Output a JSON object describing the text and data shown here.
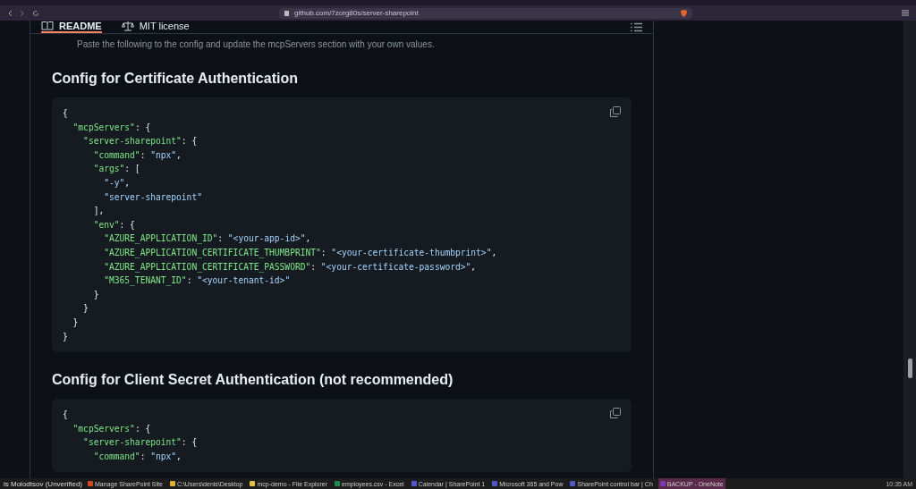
{
  "browser": {
    "url": "github.com/7zorg80s/server-sharepoint"
  },
  "readme_tabs": [
    {
      "label": "README",
      "selected": true
    },
    {
      "label": "MIT license",
      "selected": false
    }
  ],
  "intro": "Paste the following to the config and update the mcpServers section with your own values.",
  "sections": [
    {
      "heading": "Config for Certificate Authentication",
      "code": [
        [
          {
            "punct": "{"
          }
        ],
        [
          {
            "key": "  \"mcpServers\""
          },
          {
            "punct": ": {"
          }
        ],
        [
          {
            "key": "    \"server-sharepoint\""
          },
          {
            "punct": ": {"
          }
        ],
        [
          {
            "key": "      \"command\""
          },
          {
            "punct": ": "
          },
          {
            "str": "\"npx\""
          },
          {
            "punct": ","
          }
        ],
        [
          {
            "key": "      \"args\""
          },
          {
            "punct": ": ["
          }
        ],
        [
          {
            "str": "        \"-y\""
          },
          {
            "punct": ","
          }
        ],
        [
          {
            "str": "        \"server-sharepoint\""
          }
        ],
        [
          {
            "punct": "      ],"
          }
        ],
        [
          {
            "key": "      \"env\""
          },
          {
            "punct": ": {"
          }
        ],
        [
          {
            "key": "        \"AZURE_APPLICATION_ID\""
          },
          {
            "punct": ": "
          },
          {
            "str": "\"<your-app-id>\""
          },
          {
            "punct": ","
          }
        ],
        [
          {
            "key": "        \"AZURE_APPLICATION_CERTIFICATE_THUMBPRINT\""
          },
          {
            "punct": ": "
          },
          {
            "str": "\"<your-certificate-thumbprint>\""
          },
          {
            "punct": ","
          }
        ],
        [
          {
            "key": "        \"AZURE_APPLICATION_CERTIFICATE_PASSWORD\""
          },
          {
            "punct": ": "
          },
          {
            "str": "\"<your-certificate-password>\""
          },
          {
            "punct": ","
          }
        ],
        [
          {
            "key": "        \"M365_TENANT_ID\""
          },
          {
            "punct": ": "
          },
          {
            "str": "\"<your-tenant-id>\""
          }
        ],
        [
          {
            "punct": "      }"
          }
        ],
        [
          {
            "punct": "    }"
          }
        ],
        [
          {
            "punct": "  }"
          }
        ],
        [
          {
            "punct": "}"
          }
        ]
      ]
    },
    {
      "heading": "Config for Client Secret Authentication (not recommended)",
      "code": [
        [
          {
            "punct": "{"
          }
        ],
        [
          {
            "key": "  \"mcpServers\""
          },
          {
            "punct": ": {"
          }
        ],
        [
          {
            "key": "    \"server-sharepoint\""
          },
          {
            "punct": ": {"
          }
        ],
        [
          {
            "key": "      \"command\""
          },
          {
            "punct": ": "
          },
          {
            "str": "\"npx\""
          },
          {
            "punct": ","
          }
        ]
      ]
    }
  ],
  "taskbar": {
    "user": "is Molodtsov (Unverified)",
    "items": [
      {
        "label": "Manage SharePoint Site",
        "selected": false
      },
      {
        "label": "C:\\Users\\denis\\Desktop",
        "selected": false
      },
      {
        "label": "mcp-demo - File Explorer",
        "selected": false
      },
      {
        "label": "employees.csv - Excel",
        "selected": false
      },
      {
        "label": "Calendar | SharePoint 1",
        "selected": false
      },
      {
        "label": "Microsoft 365 and Pow",
        "selected": false
      },
      {
        "label": "SharePoint control bar | Ch",
        "selected": false
      },
      {
        "label": "BACKUP - OneNote",
        "selected": true
      }
    ],
    "time": "10:35 AM"
  }
}
